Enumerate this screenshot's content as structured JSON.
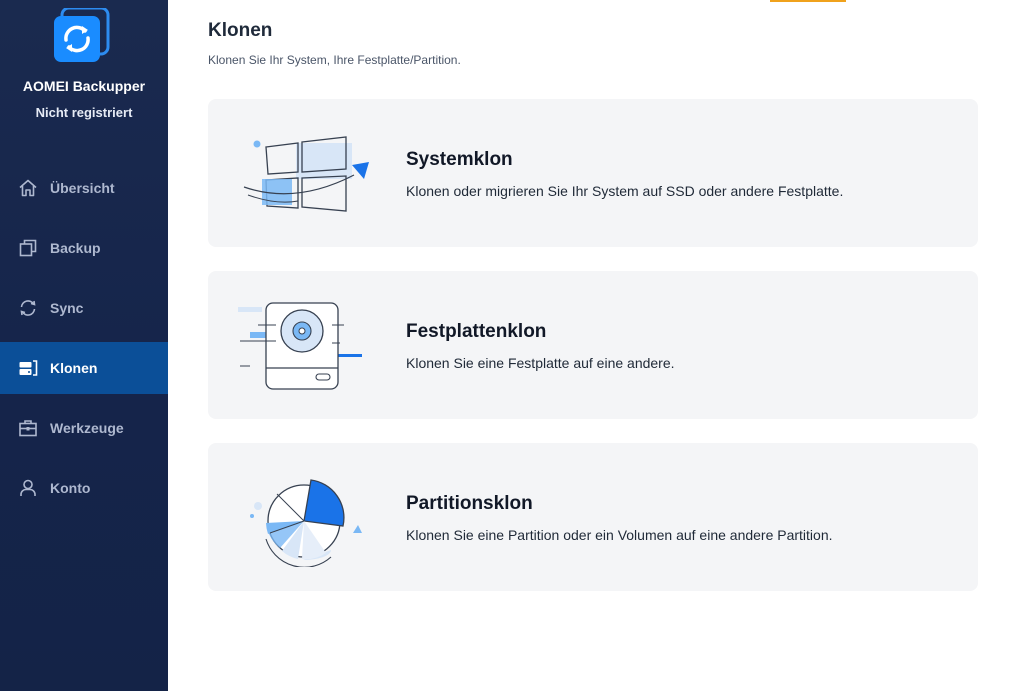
{
  "app": {
    "name": "AOMEI Backupper",
    "status": "Nicht registriert"
  },
  "sidebar": {
    "items": [
      {
        "label": "Übersicht",
        "icon": "home-icon"
      },
      {
        "label": "Backup",
        "icon": "backup-icon"
      },
      {
        "label": "Sync",
        "icon": "sync-icon"
      },
      {
        "label": "Klonen",
        "icon": "clone-icon",
        "active": true
      },
      {
        "label": "Werkzeuge",
        "icon": "toolbox-icon"
      },
      {
        "label": "Konto",
        "icon": "user-icon"
      }
    ]
  },
  "main": {
    "title": "Klonen",
    "subtitle": "Klonen Sie Ihr System, Ihre Festplatte/Partition.",
    "cards": [
      {
        "title": "Systemklon",
        "description": "Klonen oder migrieren Sie Ihr System auf SSD oder andere Festplatte.",
        "icon": "system-clone-illustration"
      },
      {
        "title": "Festplattenklon",
        "description": "Klonen Sie eine Festplatte auf eine andere.",
        "icon": "disk-clone-illustration"
      },
      {
        "title": "Partitionsklon",
        "description": "Klonen Sie eine Partition oder ein Volumen auf eine andere Partition.",
        "icon": "partition-clone-illustration"
      }
    ]
  },
  "colors": {
    "sidebar_bg": "#172649",
    "sidebar_active": "#0b4f98",
    "accent_blue": "#1a73e8",
    "card_bg": "#f4f5f7",
    "top_accent": "#f0a21c"
  }
}
